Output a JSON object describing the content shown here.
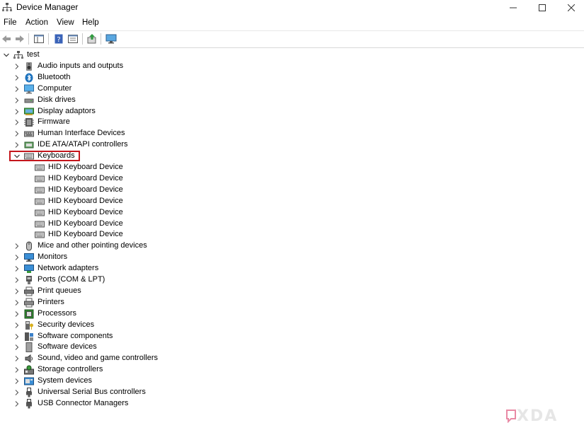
{
  "window": {
    "title": "Device Manager"
  },
  "window_controls": {
    "minimize": "—",
    "maximize": "☐",
    "close": "✕"
  },
  "menu": [
    "File",
    "Action",
    "View",
    "Help"
  ],
  "tree": {
    "root": "test",
    "categories": [
      {
        "label": "Audio inputs and outputs",
        "icon": "speaker-icon",
        "expanded": false
      },
      {
        "label": "Bluetooth",
        "icon": "bluetooth-icon",
        "expanded": false
      },
      {
        "label": "Computer",
        "icon": "computer-icon",
        "expanded": false
      },
      {
        "label": "Disk drives",
        "icon": "disk-icon",
        "expanded": false
      },
      {
        "label": "Display adaptors",
        "icon": "display-adapter-icon",
        "expanded": false
      },
      {
        "label": "Firmware",
        "icon": "firmware-icon",
        "expanded": false
      },
      {
        "label": "Human Interface Devices",
        "icon": "hid-icon",
        "expanded": false
      },
      {
        "label": "IDE ATA/ATAPI controllers",
        "icon": "ide-icon",
        "expanded": false
      },
      {
        "label": "Keyboards",
        "icon": "keyboard-icon",
        "expanded": true,
        "children": [
          "HID Keyboard Device",
          "HID Keyboard Device",
          "HID Keyboard Device",
          "HID Keyboard Device",
          "HID Keyboard Device",
          "HID Keyboard Device",
          "HID Keyboard Device"
        ]
      },
      {
        "label": "Mice and other pointing devices",
        "icon": "mouse-icon",
        "expanded": false
      },
      {
        "label": "Monitors",
        "icon": "monitor-icon",
        "expanded": false
      },
      {
        "label": "Network adapters",
        "icon": "network-icon",
        "expanded": false
      },
      {
        "label": "Ports (COM & LPT)",
        "icon": "port-icon",
        "expanded": false
      },
      {
        "label": "Print queues",
        "icon": "print-queue-icon",
        "expanded": false
      },
      {
        "label": "Printers",
        "icon": "printer-icon",
        "expanded": false
      },
      {
        "label": "Processors",
        "icon": "processor-icon",
        "expanded": false
      },
      {
        "label": "Security devices",
        "icon": "security-icon",
        "expanded": false
      },
      {
        "label": "Software components",
        "icon": "software-component-icon",
        "expanded": false
      },
      {
        "label": "Software devices",
        "icon": "software-device-icon",
        "expanded": false
      },
      {
        "label": "Sound, video and game controllers",
        "icon": "sound-icon",
        "expanded": false
      },
      {
        "label": "Storage controllers",
        "icon": "storage-icon",
        "expanded": false
      },
      {
        "label": "System devices",
        "icon": "system-icon",
        "expanded": false
      },
      {
        "label": "Universal Serial Bus controllers",
        "icon": "usb-icon",
        "expanded": false
      },
      {
        "label": "USB Connector Managers",
        "icon": "usb-connector-icon",
        "expanded": false
      }
    ]
  },
  "highlighted_item": "Keyboards",
  "colors": {
    "highlight_border": "#c4161c",
    "accent": "#1e73be"
  },
  "watermark": {
    "text": "XDA"
  }
}
